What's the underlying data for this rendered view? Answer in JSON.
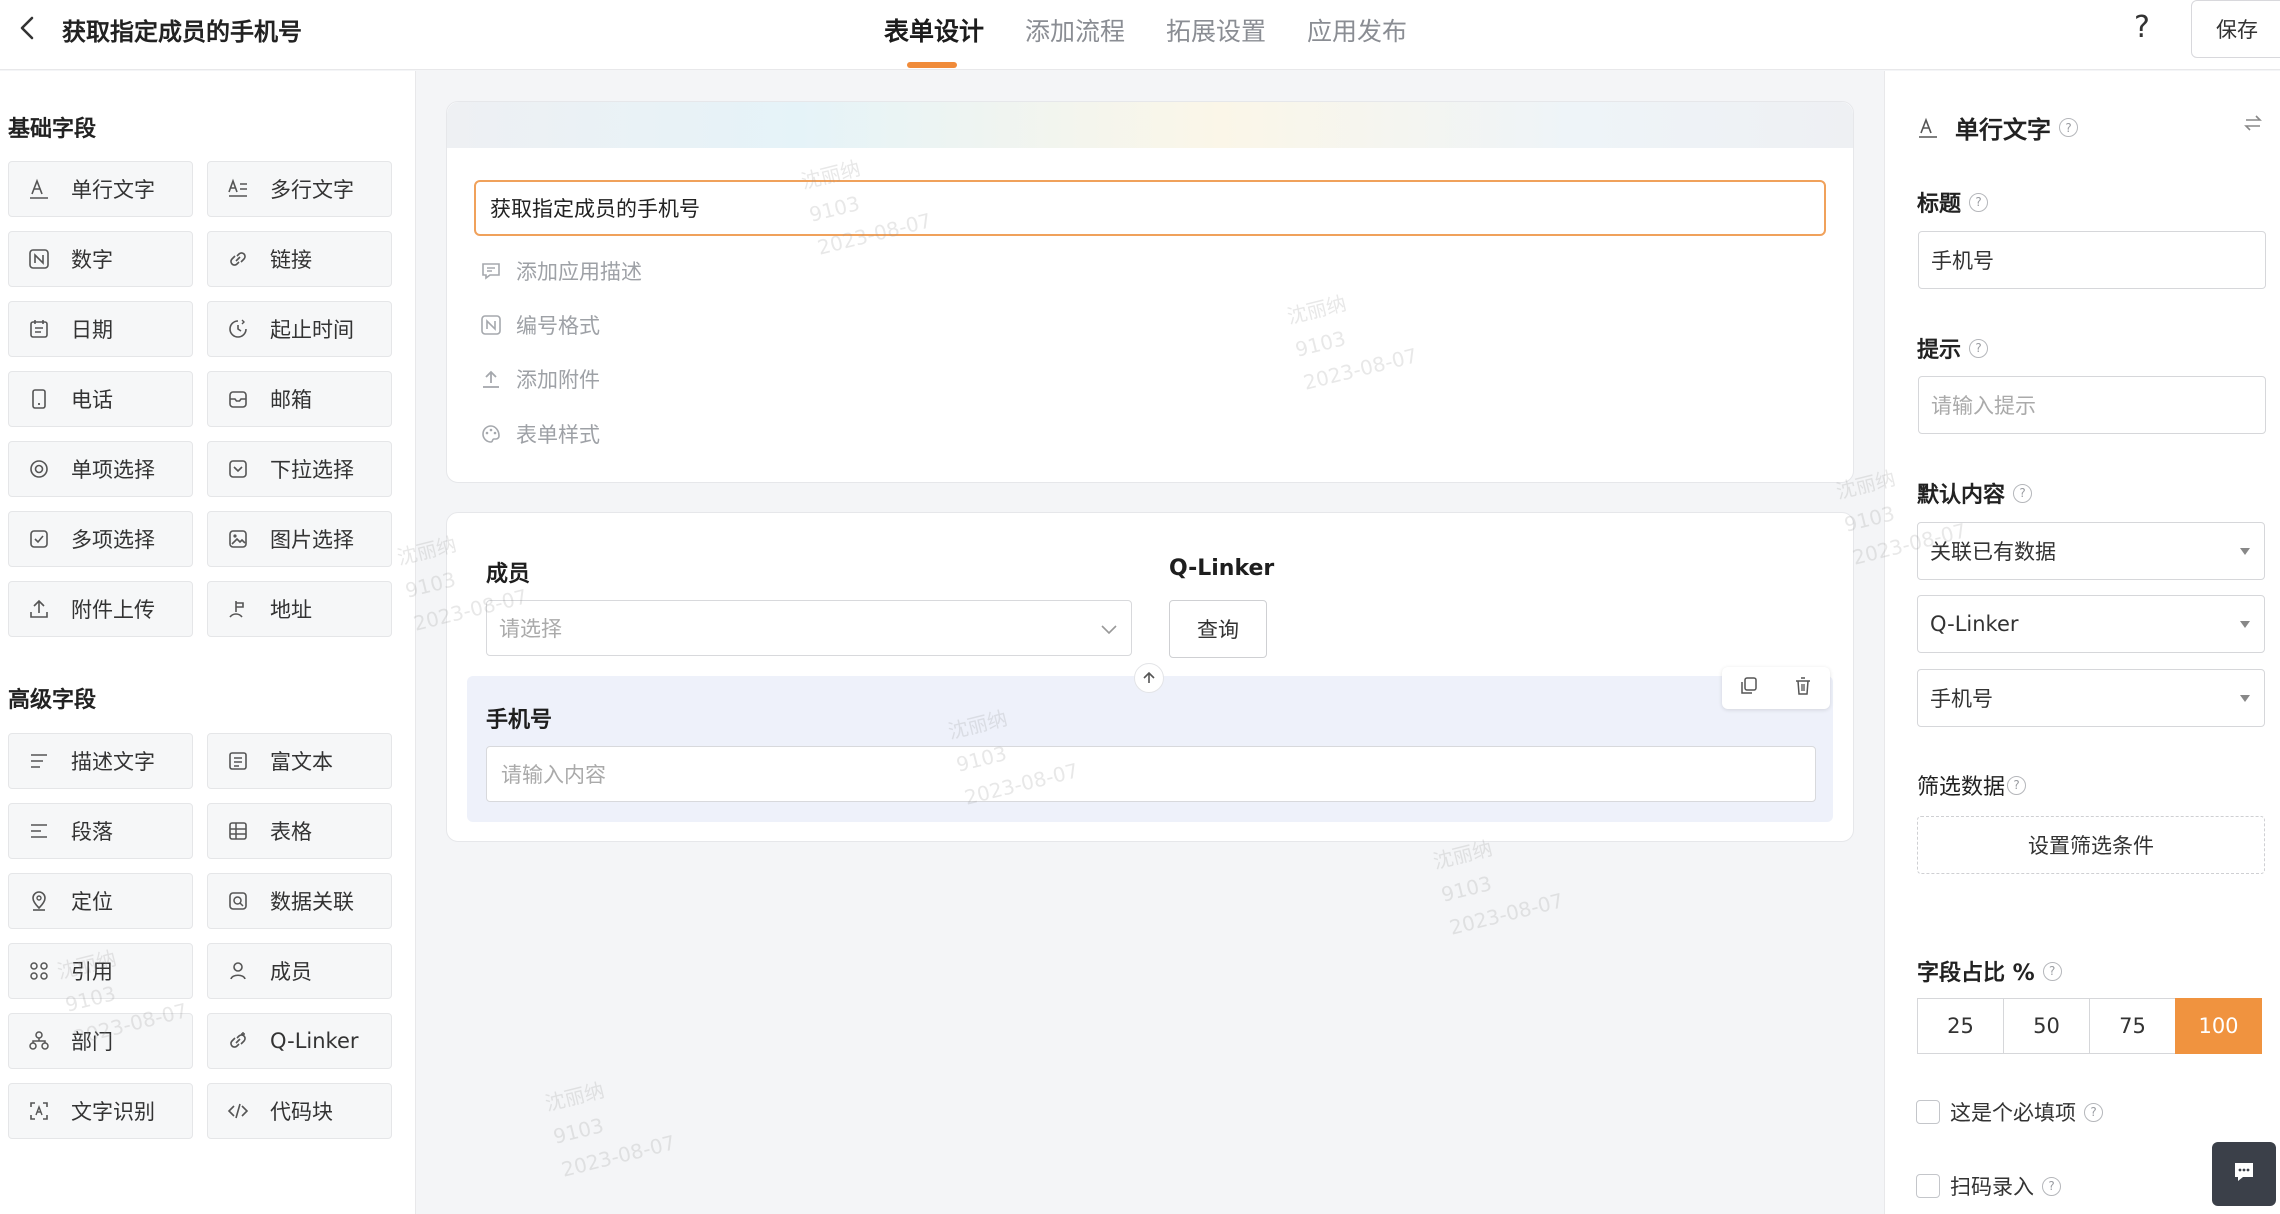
{
  "header": {
    "title": "获取指定成员的手机号",
    "tabs": [
      {
        "label": "表单设计",
        "active": true
      },
      {
        "label": "添加流程"
      },
      {
        "label": "拓展设置"
      },
      {
        "label": "应用发布"
      }
    ],
    "help": "?",
    "save_label": "保存"
  },
  "sidebar": {
    "basic_title": "基础字段",
    "basic_fields": [
      {
        "label": "单行文字",
        "icon": "text-a-icon"
      },
      {
        "label": "多行文字",
        "icon": "multiline-text-icon"
      },
      {
        "label": "数字",
        "icon": "number-icon"
      },
      {
        "label": "链接",
        "icon": "link-icon"
      },
      {
        "label": "日期",
        "icon": "calendar-icon"
      },
      {
        "label": "起止时间",
        "icon": "time-range-icon"
      },
      {
        "label": "电话",
        "icon": "phone-icon"
      },
      {
        "label": "邮箱",
        "icon": "mailbox-icon"
      },
      {
        "label": "单项选择",
        "icon": "radio-icon"
      },
      {
        "label": "下拉选择",
        "icon": "dropdown-icon"
      },
      {
        "label": "多项选择",
        "icon": "checkbox-icon"
      },
      {
        "label": "图片选择",
        "icon": "image-icon"
      },
      {
        "label": "附件上传",
        "icon": "upload-icon"
      },
      {
        "label": "地址",
        "icon": "address-icon"
      }
    ],
    "advanced_title": "高级字段",
    "advanced_fields": [
      {
        "label": "描述文字",
        "icon": "description-icon"
      },
      {
        "label": "富文本",
        "icon": "rich-text-icon"
      },
      {
        "label": "段落",
        "icon": "paragraph-icon"
      },
      {
        "label": "表格",
        "icon": "table-icon"
      },
      {
        "label": "定位",
        "icon": "location-icon"
      },
      {
        "label": "数据关联",
        "icon": "data-link-icon"
      },
      {
        "label": "引用",
        "icon": "reference-icon"
      },
      {
        "label": "成员",
        "icon": "member-icon"
      },
      {
        "label": "部门",
        "icon": "department-icon"
      },
      {
        "label": "Q-Linker",
        "icon": "q-linker-icon"
      },
      {
        "label": "文字识别",
        "icon": "ocr-icon"
      },
      {
        "label": "代码块",
        "icon": "code-icon"
      }
    ]
  },
  "form": {
    "title_value": "获取指定成员的手机号",
    "options": [
      {
        "label": "添加应用描述",
        "icon": "comment-icon"
      },
      {
        "label": "编号格式",
        "icon": "number-format-icon"
      },
      {
        "label": "添加附件",
        "icon": "attach-upload-icon"
      },
      {
        "label": "表单样式",
        "icon": "palette-icon"
      }
    ],
    "member_label": "成员",
    "member_placeholder": "请选择",
    "qlinker_label": "Q-Linker",
    "query_label": "查询",
    "phone_label": "手机号",
    "phone_placeholder": "请输入内容"
  },
  "panel": {
    "field_type": "单行文字",
    "title_label": "标题",
    "title_value": "手机号",
    "hint_label": "提示",
    "hint_placeholder": "请输入提示",
    "default_label": "默认内容",
    "default_selects": [
      "关联已有数据",
      "Q-Linker",
      "手机号"
    ],
    "filter_label": "筛选数据",
    "filter_button": "设置筛选条件",
    "ratio_label": "字段占比 %",
    "ratios": [
      "25",
      "50",
      "75",
      "100"
    ],
    "ratio_selected": "100",
    "required_label": "这是个必填项",
    "scan_label": "扫码录入"
  },
  "watermark": {
    "lines": "沈丽纳\n9103\n2023-08-07"
  },
  "colors": {
    "accent": "#f0933f",
    "title_border": "#f0a15b",
    "phone_block_bg": "#eef1fa"
  }
}
